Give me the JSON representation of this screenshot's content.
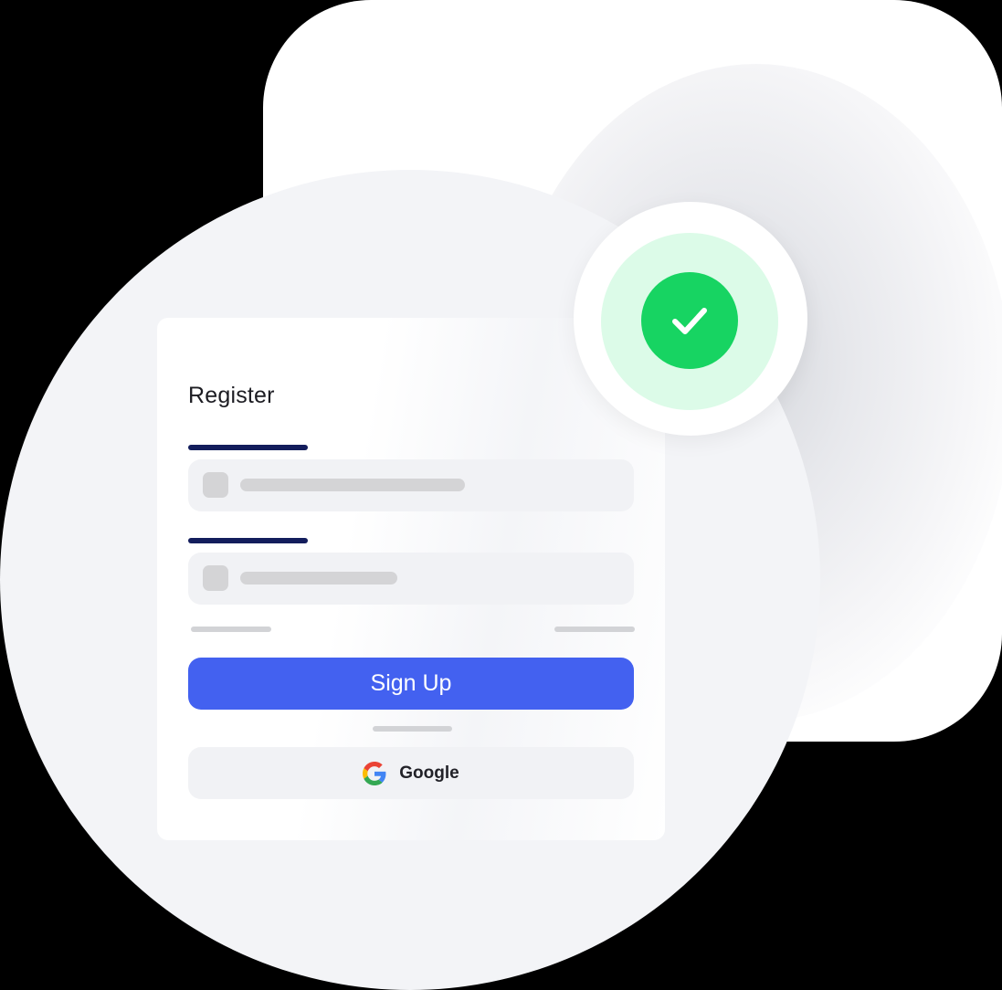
{
  "form": {
    "title": "Register",
    "fields": [
      {
        "name": "field-1"
      },
      {
        "name": "field-2"
      }
    ]
  },
  "buttons": {
    "signup_label": "Sign Up",
    "google_label": "Google"
  },
  "icons": {
    "success": "check-icon",
    "google": "google-icon"
  },
  "colors": {
    "accent": "#4361f0",
    "success": "#17d462",
    "success_light": "#dcfbe8",
    "label_bar": "#131d5c"
  }
}
